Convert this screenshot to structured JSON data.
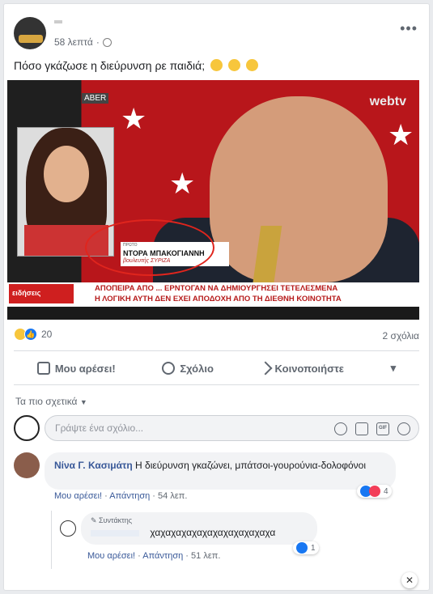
{
  "post": {
    "time": "58 λεπτά",
    "separator": "·",
    "text": "Πόσο γκάζωσε η διεύρυνση ρε παιδιά;",
    "more_icon": "more-dots-icon"
  },
  "video": {
    "name": "ΝΤΟΡΑ ΜΠΑΚΟΓΙΑΝΝΗ",
    "role": "βουλευτής ΣΥΡΙΖΑ",
    "proto": "ΠΡΩΤΟ",
    "ticker_line1": "ΑΠΟΠΕΙΡΑ ΑΠΟ ... ΕΡΝΤΟΓΑΝ ΝΑ ΔΗΜΙΟΥΡΓΗΣΕΙ ΤΕΤΕΛΕΣΜΕΝΑ",
    "ticker_line2": "Η ΛΟΓΙΚΗ ΑΥΤΗ ΔΕΝ ΕΧΕΙ ΑΠΟΔΟΧΗ ΑΠΟ ΤΗ ΔΙΕΘΝΗ ΚΟΙΝΟΤΗΤΑ",
    "news_logo": "ειδήσεις",
    "channel_logo": "webtv",
    "channel_tag": "ABER"
  },
  "stats": {
    "reaction_count": "20",
    "comments": "2 σχόλια"
  },
  "actions": {
    "like": "Μου αρέσει!",
    "comment": "Σχόλιο",
    "share": "Κοινοποιήστε"
  },
  "sort": {
    "label": "Τα πιο σχετικά"
  },
  "compose": {
    "placeholder": "Γράψτε ένα σχόλιο..."
  },
  "comments": [
    {
      "author": "Νίνα Γ. Κασιμάτη",
      "text": "Η διεύρυνση γκαζώνει, μπάτσοι-γουρούνια-δολοφόνοι",
      "like": "Μου αρέσει!",
      "reply": "Απάντηση",
      "time": "54 λεπ.",
      "reaction_count": "4"
    },
    {
      "badge": "Συντάκτης",
      "text": "χαχαχαχαχαχαχαχαχαχαχαχα",
      "like": "Μου αρέσει!",
      "reply": "Απάντηση",
      "time": "51 λεπ.",
      "reaction_count": "1"
    }
  ],
  "colors": {
    "link": "#385898",
    "like_blue": "#1877f2",
    "text_gray": "#606770"
  }
}
